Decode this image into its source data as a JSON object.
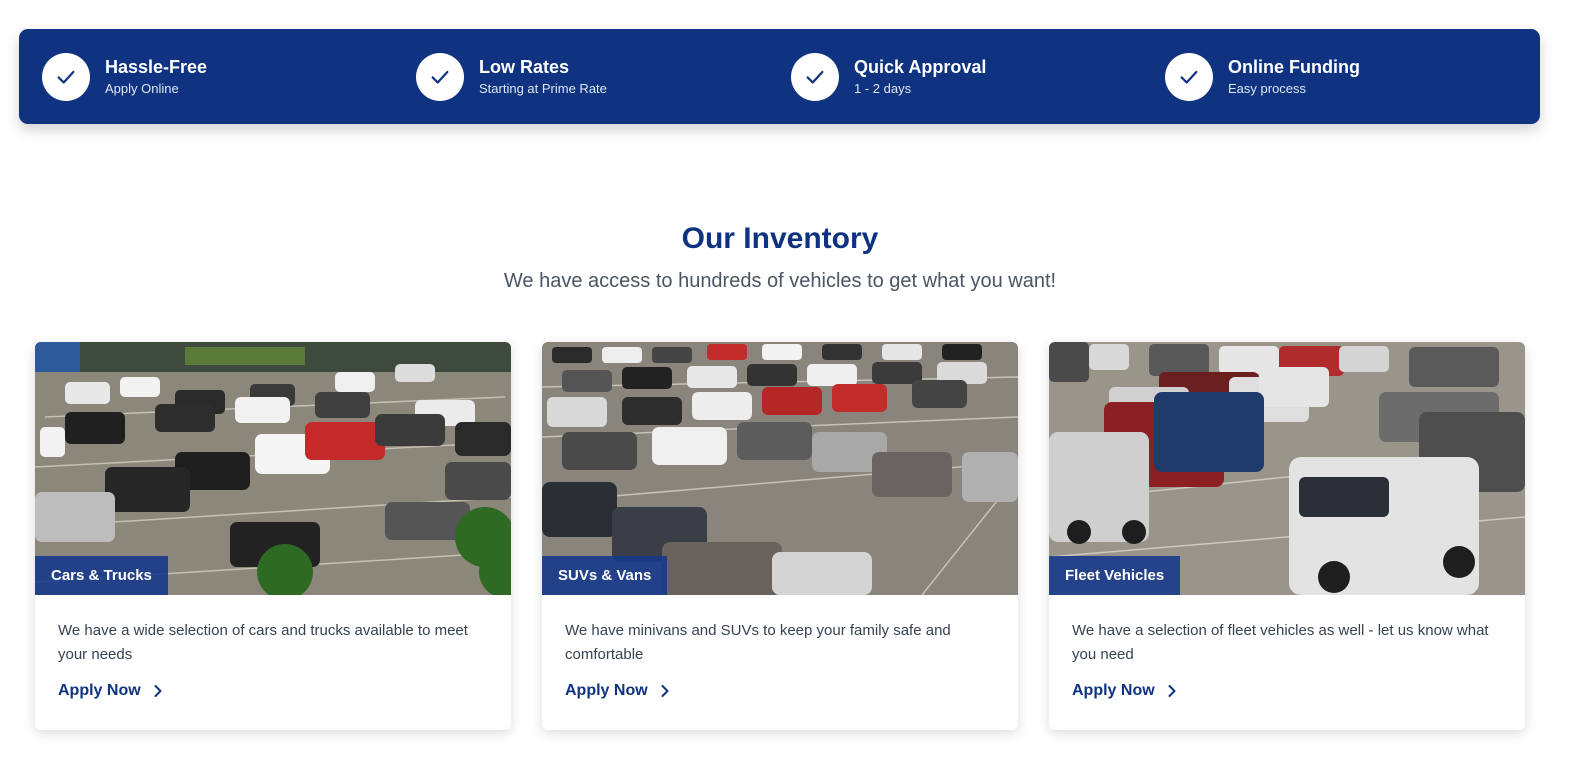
{
  "features": [
    {
      "title": "Hassle-Free",
      "subtitle": "Apply Online",
      "icon": "check-icon"
    },
    {
      "title": "Low Rates",
      "subtitle": "Starting at Prime Rate",
      "icon": "check-icon"
    },
    {
      "title": "Quick Approval",
      "subtitle": "1 - 2 days",
      "icon": "check-icon"
    },
    {
      "title": "Online Funding",
      "subtitle": "Easy process",
      "icon": "check-icon"
    }
  ],
  "inventory": {
    "title": "Our Inventory",
    "subtitle": "We have access to hundreds of vehicles to get what you want!",
    "cards": [
      {
        "label": "Cars & Trucks",
        "description": "We have a wide selection of cars and trucks available to meet your needs",
        "link": "Apply Now",
        "link_icon": "chevron-right-icon"
      },
      {
        "label": "SUVs & Vans",
        "description": "We have minivans and SUVs to keep your family safe and comfortable",
        "link": "Apply Now",
        "link_icon": "chevron-right-icon"
      },
      {
        "label": "Fleet Vehicles",
        "description": "We have a selection of fleet vehicles as well - let us know what you need",
        "link": "Apply Now",
        "link_icon": "chevron-right-icon"
      }
    ]
  },
  "colors": {
    "brand_navy": "#0f3380",
    "label_overlay": "#15388a",
    "text_gray": "#4b5563"
  }
}
